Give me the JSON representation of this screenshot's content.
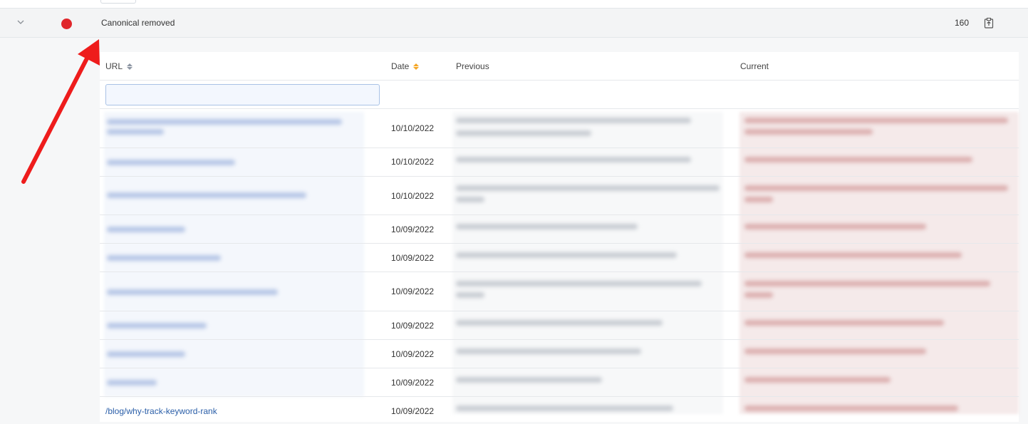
{
  "issue": {
    "title": "Canonical removed",
    "count": "160",
    "status_color": "#e0262b",
    "expand_icon": "chevron-down-icon",
    "export_icon": "export-icon"
  },
  "table": {
    "columns": {
      "url": "URL",
      "date": "Date",
      "previous": "Previous",
      "current": "Current"
    },
    "url_filter": {
      "value": "",
      "placeholder": ""
    },
    "sorted_column": "date",
    "rows": [
      {
        "date": "10/10/2022",
        "url": ""
      },
      {
        "date": "10/10/2022",
        "url": ""
      },
      {
        "date": "10/10/2022",
        "url": ""
      },
      {
        "date": "10/09/2022",
        "url": ""
      },
      {
        "date": "10/09/2022",
        "url": ""
      },
      {
        "date": "10/09/2022",
        "url": ""
      },
      {
        "date": "10/09/2022",
        "url": ""
      },
      {
        "date": "10/09/2022",
        "url": ""
      },
      {
        "date": "10/09/2022",
        "url": ""
      },
      {
        "date": "10/09/2022",
        "url": "/blog/why-track-keyword-rank"
      }
    ]
  },
  "annotation": {
    "arrow_color": "#ee1c1c"
  }
}
